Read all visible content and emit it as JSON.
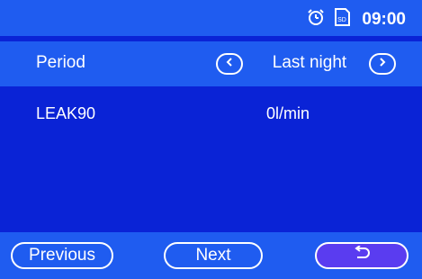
{
  "status_bar": {
    "alarm_icon": "alarm-clock-icon",
    "sd_icon": "sd-card-icon",
    "sd_text": "SD",
    "time": "09:00"
  },
  "period_row": {
    "label": "Period",
    "value": "Last night",
    "prev_icon": "chevron-left-icon",
    "next_icon": "chevron-right-icon"
  },
  "data_row": {
    "label": "LEAK90",
    "value": "0l/min"
  },
  "bottom_bar": {
    "previous_label": "Previous",
    "next_label": "Next",
    "back_icon": "return-arrow-icon"
  },
  "colors": {
    "primary_blue": "#1f5cf0",
    "deep_blue": "#0a23d6",
    "accent_violet": "#5a3cf0",
    "text": "#ffffff"
  }
}
